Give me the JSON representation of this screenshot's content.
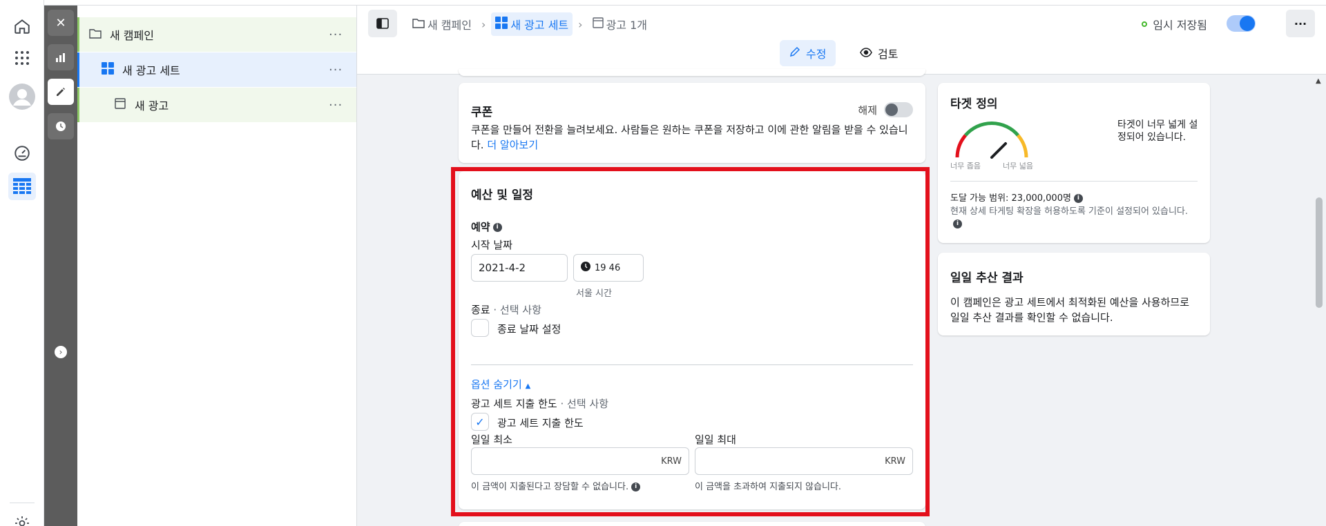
{
  "rail": {
    "icons": [
      "home-icon",
      "apps-grid-icon",
      "profile-avatar-icon",
      "performance-gauge-icon",
      "ads-manager-table-icon",
      "settings-gear-icon"
    ]
  },
  "strip": {
    "buttons": [
      "close-icon",
      "bar-chart-icon",
      "edit-pencil-icon",
      "history-clock-icon"
    ],
    "expand": "›"
  },
  "tree": {
    "campaign": "새 캠페인",
    "adset": "새 광고 세트",
    "ad": "새 광고",
    "more": "···"
  },
  "topbar": {
    "crumbs": [
      "새 캠페인",
      "새 광고 세트",
      "광고 1개"
    ],
    "autosave": "임시 저장됨",
    "more": "···",
    "edit": "수정",
    "review": "검토"
  },
  "coupon": {
    "title": "쿠폰",
    "desc": "쿠폰을 만들어 전환을 늘려보세요. 사람들은 원하는 쿠폰을 저장하고 이에 관한 알림을 받을 수 있습니다.",
    "link": "더 알아보기",
    "toggle_label": "해제"
  },
  "budget": {
    "title": "예산 및 일정",
    "schedule": "예약",
    "start_label": "시작 날짜",
    "start_date": "2021-4-2",
    "start_time": "19 46",
    "timezone": "서울 시간",
    "end_label": "종료",
    "optional": " · 선택 사항",
    "end_checkbox": "종료 날짜 설정",
    "hide_options": "옵션 숨기기",
    "limit_label": "광고 세트 지출 한도",
    "limit_checkbox": "광고 세트 지출 한도",
    "daily_min_label": "일일 최소",
    "daily_max_label": "일일 최대",
    "currency": "KRW",
    "min_help": "이 금액이 지출된다고 장담할 수 없습니다.",
    "max_help": "이 금액을 초과하여 지출되지 않습니다."
  },
  "target": {
    "title": "타겟 정의",
    "gauge_low": "너무 좁음",
    "gauge_high": "너무 넓음",
    "status": "타겟이 너무 넓게 설정되어 있습니다.",
    "reach": "도달 가능 범위: 23,000,000명",
    "note": "현재 상세 타게팅 확장을 허용하도록 기준이 설정되어 있습니다."
  },
  "daily_results": {
    "title": "일일 추산 결과",
    "desc": "이 캠페인은 광고 세트에서 최적화된 예산을 사용하므로 일일 추산 결과를 확인할 수 없습니다."
  },
  "colors": {
    "accent": "#1877f2",
    "highlight": "#e3101c",
    "tree_green": "#f1f8ec"
  }
}
